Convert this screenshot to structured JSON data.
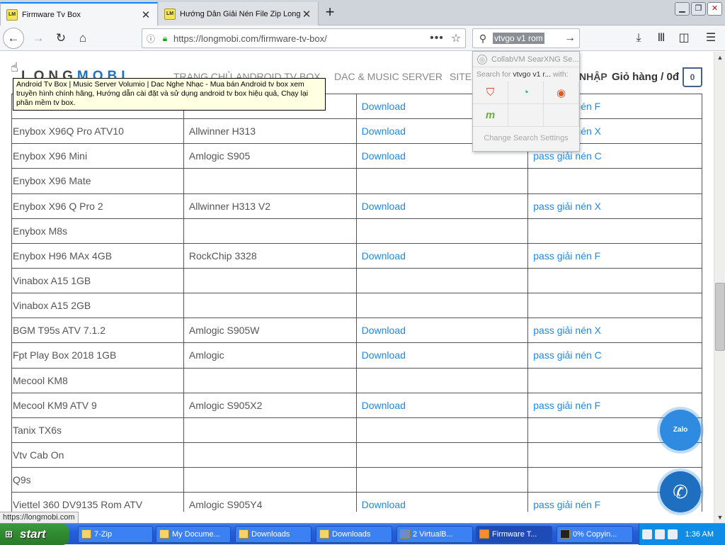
{
  "browser": {
    "tabs": [
      {
        "label": "Firmware Tv Box",
        "active": true
      },
      {
        "label": "Hướng Dẫn Giải Nén File Zip Longm",
        "active": false
      }
    ],
    "url_domain": "https://longmobi.com",
    "url_path": "/firmware-tv-box/",
    "search_value": "vtvgo v1 rom"
  },
  "search_dropdown": {
    "engine": "CollabVM SearXNG Se...",
    "search_for_prefix": "Search for",
    "search_for_query": "vtvgo v1 r...",
    "search_for_suffix": "with:",
    "settings": "Change Search Settings"
  },
  "site": {
    "logo_left": "LONG",
    "logo_right": "MOBI",
    "nav": [
      {
        "label": "TRANG CHỦ"
      },
      {
        "label": "ANDROID TV BOX"
      },
      {
        "label": "DAC & MUSIC SERVER"
      },
      {
        "label": "SITE"
      }
    ],
    "login": "NHẬP",
    "cart_label": "Giỏ hàng / 0đ",
    "cart_count": "0"
  },
  "tooltip": "Android Tv Box | Music Server Volumio | Dac Nghe Nhạc - Mua bán Android tv box xem truyền hình chính hãng, Hướng dẫn cài đặt và sử dụng android tv box hiệu quả, Chạy lại phần mềm tv box.",
  "table": {
    "rows": [
      [
        "",
        "",
        "Download",
        "pass giải nén F"
      ],
      [
        "Enybox X96Q Pro ATV10",
        "Allwinner H313",
        "Download",
        "pass giải nén X"
      ],
      [
        "Enybox X96 Mini",
        "Amlogic S905",
        "Download",
        "pass giải nén C"
      ],
      [
        "Enybox X96 Mate",
        "",
        "",
        ""
      ],
      [
        "Enybox X96 Q Pro 2",
        "Allwinner H313 V2",
        "Download",
        "pass giải nén X"
      ],
      [
        "Enybox M8s",
        "",
        "",
        ""
      ],
      [
        "Enybox H96 MAx 4GB",
        "RockChip 3328",
        "Download",
        "pass giải nén F"
      ],
      [
        "Vinabox A15 1GB",
        "",
        "",
        ""
      ],
      [
        "Vinabox A15 2GB",
        "",
        "",
        ""
      ],
      [
        "BGM T95s ATV 7.1.2",
        "Amlogic S905W",
        "Download",
        "pass giải nén X"
      ],
      [
        "Fpt Play Box 2018 1GB",
        "Amlogic",
        "Download",
        "pass giải nén C"
      ],
      [
        "Mecool KM8",
        "",
        "",
        ""
      ],
      [
        "Mecool KM9 ATV 9",
        "Amlogic S905X2",
        "Download",
        "pass giải nén F"
      ],
      [
        "Tanix TX6s",
        "",
        "",
        ""
      ],
      [
        "Vtv Cab On",
        "",
        "",
        ""
      ],
      [
        "Q9s",
        "",
        "",
        ""
      ],
      [
        "Viettel 360 DV9135 Rom ATV",
        "Amlogic S905Y4",
        "Download",
        "pass giải nén F"
      ]
    ]
  },
  "floating": {
    "zalo": "Zalo"
  },
  "status_url": "https://longmobi.com",
  "taskbar": {
    "start": "start",
    "tasks": [
      {
        "label": "7-Zip"
      },
      {
        "label": "My Docume..."
      },
      {
        "label": "Downloads"
      },
      {
        "label": "Downloads"
      },
      {
        "label": "2 VirtualB..."
      },
      {
        "label": "Firmware T..."
      },
      {
        "label": "0% Copyin..."
      }
    ],
    "clock": "1:36 AM"
  },
  "colors": {
    "link": "#1e88e5",
    "accent": "#0a84ff",
    "zalo": "#2e8be0"
  }
}
